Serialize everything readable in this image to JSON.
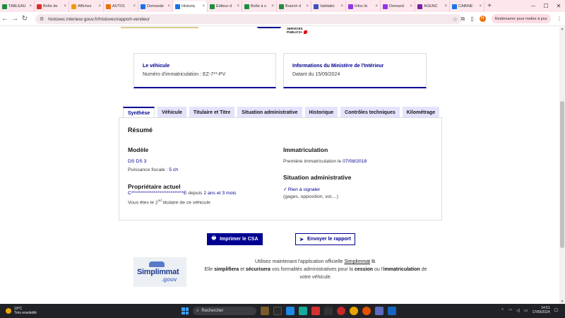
{
  "browser": {
    "tabs": [
      {
        "label": "TABLEAU",
        "color": "#1e8e3e",
        "active": false
      },
      {
        "label": "Boîte de",
        "color": "#d93025",
        "active": false
      },
      {
        "label": "Affichez",
        "color": "#f29900",
        "active": false
      },
      {
        "label": "AUTO1",
        "color": "#e8710a",
        "active": false
      },
      {
        "label": "Demande",
        "color": "#1a73e8",
        "active": false
      },
      {
        "label": "Historiq",
        "color": "#1a73e8",
        "active": true
      },
      {
        "label": "Éditeur d",
        "color": "#1e8e3e",
        "active": false
      },
      {
        "label": "Boîte à o",
        "color": "#1e8e3e",
        "active": false
      },
      {
        "label": "Branch d",
        "color": "#1e8e3e",
        "active": false
      },
      {
        "label": "Validatio",
        "color": "#3f51b5",
        "active": false
      },
      {
        "label": "Infos lic",
        "color": "#9334e6",
        "active": false
      },
      {
        "label": "Demand",
        "color": "#9334e6",
        "active": false
      },
      {
        "label": "AGENC",
        "color": "#7b1fa2",
        "active": false
      },
      {
        "label": "CABINE",
        "color": "#1a73e8",
        "active": false
      }
    ],
    "new_tab": "+",
    "url": "histovec.interieur.gouv.fr/histovec/rapport-vendeur",
    "avatar_letter": "N",
    "restart_label": "Redémarrer pour mettre à jour"
  },
  "header": {
    "sp_logo_line1": "SERVICES",
    "sp_logo_line2": "PUBLICS+"
  },
  "cards": {
    "vehicle_title": "Le véhicule",
    "vehicle_text": "Numéro d'immatriculation : EZ-7**-PV",
    "ministry_title": "Informations du Ministère de l'Intérieur",
    "ministry_text": "Datant du 15/09/2024"
  },
  "report_tabs": [
    "Synthèse",
    "Véhicule",
    "Titulaire et Titre",
    "Situation administrative",
    "Historique",
    "Contrôles techniques",
    "Kilométrage"
  ],
  "summary": {
    "title": "Résumé",
    "model_heading": "Modèle",
    "model_value": "DS DS 3",
    "power_label": "Puissance fiscale :",
    "power_value": "5 ch",
    "owner_heading": "Propriétaire actuel",
    "owner_name": "C****************************E",
    "owner_since_label": "depuis",
    "owner_since_value": "2 ans et 3 mois",
    "owner_rank_prefix": "Vous êtes le",
    "owner_rank_num": "2",
    "owner_rank_sup": "nd",
    "owner_rank_suffix": "titulaire de ce véhicule",
    "registration_heading": "Immatriculation",
    "first_reg_label": "Première immatriculation le",
    "first_reg_value": "07/08/2018",
    "admin_heading": "Situation administrative",
    "admin_value": "Rien à signaler",
    "admin_detail": "(gages, opposition, vol,...)"
  },
  "actions": {
    "print_label": "Imprimer le CSA",
    "send_label": "Envoyer le rapport"
  },
  "promo": {
    "logo_text": "Simplimmat",
    "logo_sub": ".gouv",
    "line1_prefix": "Utilisez maintenant l'application officielle",
    "line1_link": "Simplimmat",
    "line2_a": "Elle",
    "line2_b": "simplifiera",
    "line2_c": "et",
    "line2_d": "sécurisera",
    "line2_e": "vos formalités administratives pour la",
    "line2_f": "cession",
    "line2_g": "ou l'",
    "line2_h": "immatriculation",
    "line2_i": "de",
    "line3": "votre véhicule."
  },
  "taskbar": {
    "temp": "19°C",
    "weather": "Très ensoleillé",
    "search_placeholder": "Rechercher",
    "time": "14:51",
    "date": "17/09/2024"
  }
}
